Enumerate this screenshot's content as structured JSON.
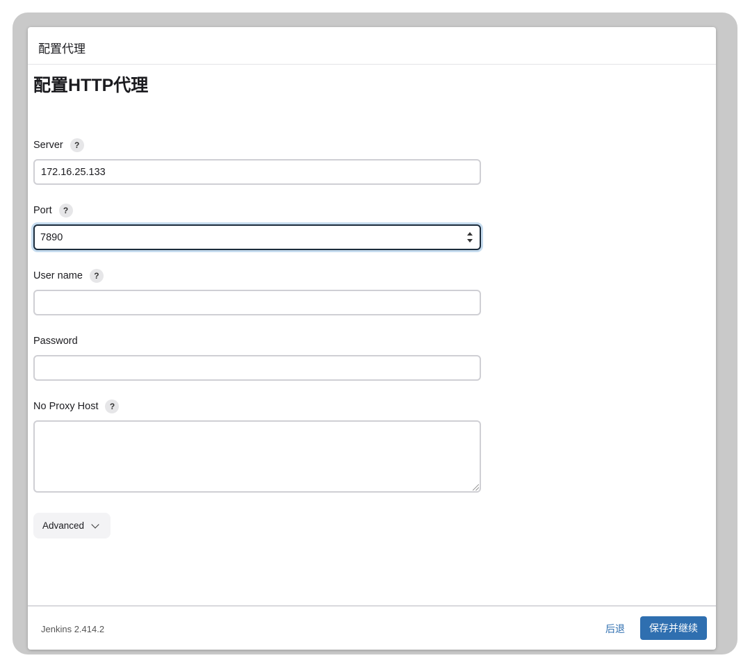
{
  "dialog": {
    "title": "配置代理"
  },
  "form": {
    "heading": "配置HTTP代理",
    "help_glyph": "?",
    "server": {
      "label": "Server",
      "value": "172.16.25.133"
    },
    "port": {
      "label": "Port",
      "value": "7890"
    },
    "username": {
      "label": "User name",
      "value": ""
    },
    "password": {
      "label": "Password",
      "value": ""
    },
    "no_proxy_host": {
      "label": "No Proxy Host",
      "value": ""
    },
    "advanced_label": "Advanced"
  },
  "footer": {
    "version": "Jenkins 2.414.2",
    "back_label": "后退",
    "save_label": "保存并继续"
  },
  "colors": {
    "accent": "#2f6fb0",
    "focus_ring": "#c6dcef",
    "focus_border": "#1b2b3b"
  },
  "icons": {
    "help": "help-icon",
    "advanced": "chevron-down-icon",
    "port_spinner": "spinner-icon"
  }
}
